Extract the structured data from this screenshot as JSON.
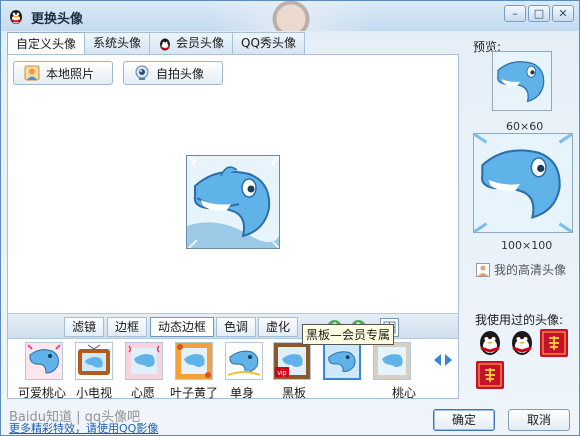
{
  "window": {
    "title": "更换头像",
    "minimize_icon": "minimize-icon",
    "maximize_icon": "maximize-icon",
    "close_icon": "close-icon"
  },
  "tabs": [
    {
      "label": "自定义头像",
      "active": true
    },
    {
      "label": "系统头像",
      "active": false
    },
    {
      "label": "会员头像",
      "active": false,
      "icon": "qq-penguin-icon"
    },
    {
      "label": "QQ秀头像",
      "active": false
    }
  ],
  "source_buttons": {
    "local_photo": "本地照片",
    "self_shot": "自拍头像"
  },
  "effect_tabs": [
    {
      "label": "滤镜",
      "active": false
    },
    {
      "label": "边框",
      "active": false
    },
    {
      "label": "动态边框",
      "active": true
    },
    {
      "label": "色调",
      "active": false
    },
    {
      "label": "虚化",
      "active": false
    }
  ],
  "tools": {
    "rotate_left": "rotate-left-icon",
    "rotate_right": "rotate-right-icon",
    "grid": "grid-icon"
  },
  "frames": [
    {
      "label": "可爱桃心",
      "selected": false
    },
    {
      "label": "小电视",
      "selected": false
    },
    {
      "label": "心愿",
      "selected": false
    },
    {
      "label": "叶子黄了",
      "selected": false
    },
    {
      "label": "单身",
      "selected": false
    },
    {
      "label": "黑板",
      "selected": false,
      "badge": "vip"
    },
    {
      "label": "",
      "selected": true
    },
    {
      "label": "桃心",
      "selected": false
    }
  ],
  "tooltip": "黑板—会员专属",
  "preview": {
    "label": "预览:",
    "small_size": "60×60",
    "large_size": "100×100",
    "hd_label": "我的高清头像"
  },
  "used_avatars": {
    "label": "我使用过的头像:",
    "items": [
      "qq-penguin-icon",
      "qq-penguin-icon",
      "fu-red-icon",
      "fu-red-icon"
    ]
  },
  "footer": {
    "watermark": "Baidu知道 | qq头像吧",
    "link": "更多精彩特效，请使用QQ影像",
    "ok": "确定",
    "cancel": "取消"
  },
  "colors": {
    "accent": "#3c86d9",
    "frame_blue": "#5fb3e8"
  }
}
